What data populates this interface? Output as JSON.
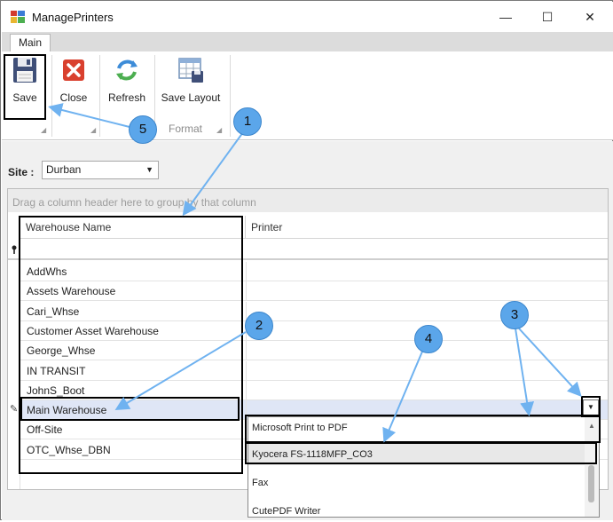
{
  "window": {
    "title": "ManagePrinters",
    "minimize": "—",
    "maximize": "☐",
    "close": "✕"
  },
  "ribbon": {
    "tab": "Main",
    "buttons": {
      "save": "Save",
      "close": "Close",
      "refresh": "Refresh",
      "save_layout": "Save Layout"
    },
    "group_label": "Format"
  },
  "site": {
    "label": "Site :",
    "value": "Durban"
  },
  "grid": {
    "group_panel_text": "Drag a column header here to group by that column",
    "columns": [
      "Warehouse Name",
      "Printer"
    ],
    "rows": [
      "AddWhs",
      "Assets Warehouse",
      "Cari_Whse",
      "Customer Asset Warehouse",
      "George_Whse",
      "IN TRANSIT",
      "JohnS_Boot",
      "Main Warehouse",
      "Off-Site",
      "OTC_Whse_DBN"
    ],
    "selected_row": "Main Warehouse"
  },
  "printer_dropdown": {
    "options": [
      "Microsoft Print to PDF",
      "Kyocera FS-1118MFP_CO3",
      "Fax",
      "CutePDF Writer"
    ],
    "highlighted": "Kyocera FS-1118MFP_CO3"
  },
  "callouts": [
    "1",
    "2",
    "3",
    "4",
    "5"
  ],
  "colors": {
    "callout_fill": "#5ba6ea",
    "arrow": "#6fb2f0",
    "selection": "#dfe6f6",
    "highlight_box": "#000000"
  }
}
